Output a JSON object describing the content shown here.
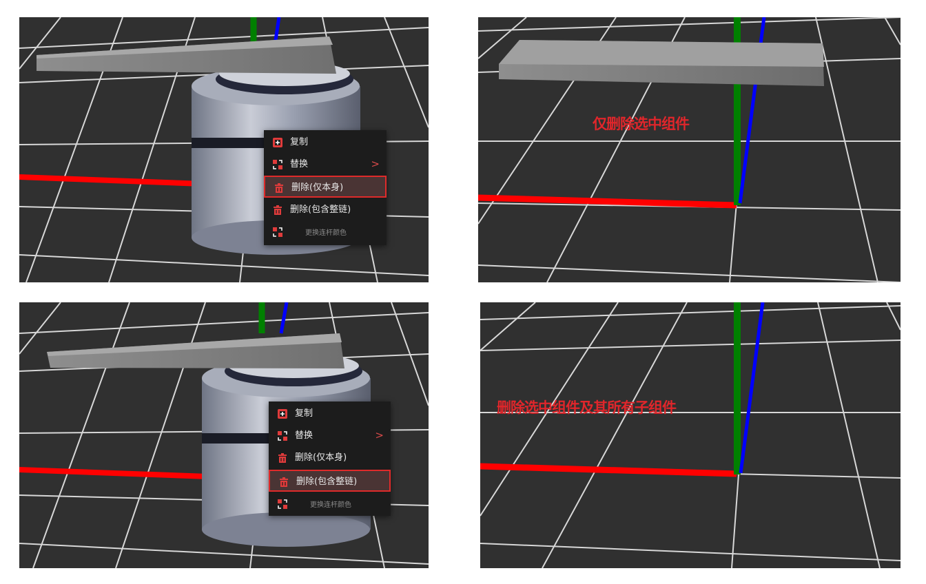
{
  "menu": {
    "items": [
      {
        "label": "复制",
        "icon": "copy-icon"
      },
      {
        "label": "替换",
        "icon": "replace-icon",
        "submenu_arrow": ">"
      },
      {
        "label": "删除(仅本身)",
        "icon": "trash-icon"
      },
      {
        "label": "删除(包含整链)",
        "icon": "trash-icon"
      },
      {
        "label": "更换连杆颜色",
        "icon": "replace-icon"
      }
    ]
  },
  "panels": {
    "top_left": {
      "highlighted_item": "删除(仅本身)"
    },
    "top_right": {
      "caption": "仅删除选中组件"
    },
    "bottom_left": {
      "highlighted_item": "删除(包含整链)"
    },
    "bottom_right": {
      "caption": "删除选中组件及其所有子组件"
    }
  },
  "colors": {
    "background": "#303030",
    "grid": "#d8d8d8",
    "axis_x": "#ff0000",
    "axis_y": "#008000",
    "axis_z": "#0000ff",
    "accent": "#e02a2a",
    "menu_bg": "#1c1c1c"
  }
}
